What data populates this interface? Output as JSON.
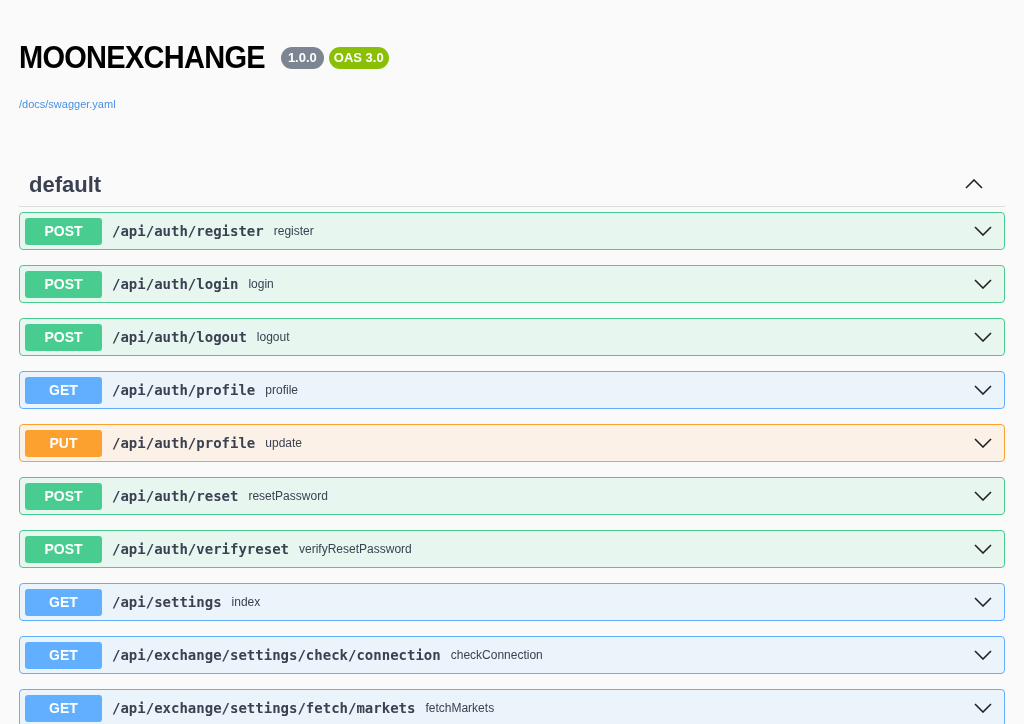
{
  "info": {
    "title": "MOONEXCHANGE",
    "version": "1.0.0",
    "oas": "OAS 3.0",
    "link": "/docs/swagger.yaml"
  },
  "section": {
    "name": "default",
    "expanded": true,
    "operations": [
      {
        "method": "POST",
        "path": "/api/auth/register",
        "summary": "register",
        "expanded": false
      },
      {
        "method": "POST",
        "path": "/api/auth/login",
        "summary": "login",
        "expanded": false
      },
      {
        "method": "POST",
        "path": "/api/auth/logout",
        "summary": "logout",
        "expanded": false
      },
      {
        "method": "GET",
        "path": "/api/auth/profile",
        "summary": "profile",
        "expanded": false
      },
      {
        "method": "PUT",
        "path": "/api/auth/profile",
        "summary": "update",
        "expanded": false
      },
      {
        "method": "POST",
        "path": "/api/auth/reset",
        "summary": "resetPassword",
        "expanded": false
      },
      {
        "method": "POST",
        "path": "/api/auth/verifyreset",
        "summary": "verifyResetPassword",
        "expanded": false
      },
      {
        "method": "GET",
        "path": "/api/settings",
        "summary": "index",
        "expanded": false
      },
      {
        "method": "GET",
        "path": "/api/exchange/settings/check/connection",
        "summary": "checkConnection",
        "expanded": false
      },
      {
        "method": "GET",
        "path": "/api/exchange/settings/fetch/markets",
        "summary": "fetchMarkets",
        "expanded": false
      }
    ]
  }
}
